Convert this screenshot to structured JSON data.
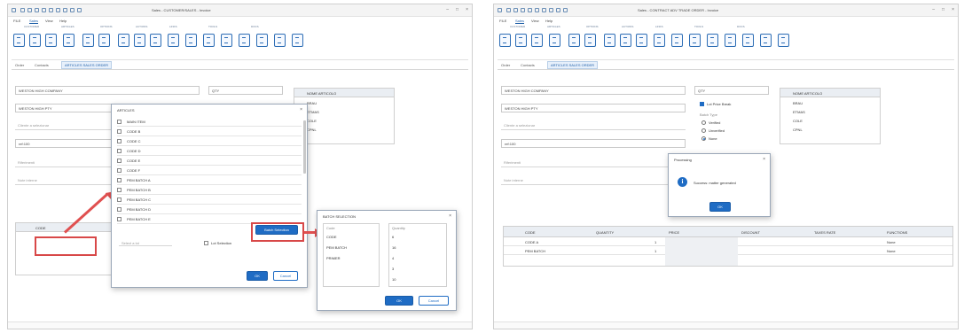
{
  "left": {
    "title_text": "Sales - CUSTOMER/SALES - Invoice",
    "menu": [
      "FILE",
      "Sales",
      "View",
      "Help"
    ],
    "menu_active_index": 1,
    "ribbon_groups": [
      "CUSTOMER",
      "ARTICLES",
      "OPTIONS",
      "ACTIONS",
      "LINKS",
      "TOOLS",
      "DOCS"
    ],
    "doc_tabs": [
      "Order",
      "Contacts",
      "ARTICLES SALES ORDER"
    ],
    "form": {
      "customer": "WESTON HIGH COMPANY",
      "customer_alt": "WESTON HIGH PTY",
      "qty_label": "QTY",
      "placeholder_1": "Cliente a selezionar",
      "ref": "ref:100",
      "field_b": "Riferimenti",
      "field_c": "Note interne"
    },
    "side_grid": {
      "header": "NOME ARTICOLO",
      "rows": [
        "BRAU",
        "ETMAS",
        "COLE",
        "CPNL"
      ]
    },
    "main_grid": {
      "header": "CODE"
    },
    "article_dialog": {
      "title": "ARTICLES",
      "items": [
        "MAIN ITEM",
        "CODE B",
        "CODE C",
        "CODE D",
        "CODE E",
        "CODE F",
        "PEM BATCH A",
        "PEM BATCH B",
        "PEM BATCH C",
        "PEM BATCH D",
        "PEM BATCH E"
      ],
      "button_label": "Batch Selection",
      "ok": "OK",
      "cancel": "Cancel",
      "footer_check": "Lot Selection",
      "footer_left": "Select a lot"
    },
    "batch_dialog": {
      "title": "BATCH SELECTION",
      "col_a": "Code",
      "col_b": "Quantity",
      "rows_a": [
        "CODE",
        "PEM BATCH",
        "PRIMER"
      ],
      "rows_b": [
        "6",
        "16",
        "4",
        "3",
        "10"
      ],
      "ok": "OK",
      "cancel": "Cancel"
    }
  },
  "right": {
    "title_text": "Sales - CONTRACT ADV TRADE ORDER - Invoice",
    "menu": [
      "FILE",
      "Sales",
      "View",
      "Help"
    ],
    "menu_active_index": 1,
    "ribbon_groups": [
      "CUSTOMER",
      "ARTICLES",
      "OPTIONS",
      "ACTIONS",
      "LINKS",
      "TOOLS",
      "DOCS"
    ],
    "doc_tabs": [
      "Order",
      "Contacts",
      "ARTICLES SALES ORDER"
    ],
    "form": {
      "customer": "WESTON HIGH COMPANY",
      "customer_alt": "WESTON HIGH PTY",
      "qty_label": "QTY",
      "placeholder_1": "Cliente a selezionar",
      "ref": "ref:100",
      "field_b": "Riferimenti",
      "field_c": "Note interne"
    },
    "options_panel": {
      "check_label": "Lot Price Break",
      "group_label": "Batch Type",
      "radios": [
        "Verified",
        "Unverified",
        "None"
      ],
      "selected_radio": 2
    },
    "side_grid": {
      "header": "NOME ARTICOLO",
      "rows": [
        "BRAU",
        "ETMAS",
        "COLE",
        "CPNL"
      ]
    },
    "message_box": {
      "title": "Processing",
      "message": "Success: matter generated",
      "ok": "OK",
      "icon": "info-icon"
    },
    "main_grid": {
      "headers": [
        "CODE",
        "QUANTITY",
        "PRICE",
        "DISCOUNT",
        "TAXES RATE",
        "FUNCTIONS"
      ],
      "rows": [
        [
          "CODE A",
          "1",
          "",
          "",
          "",
          "None"
        ],
        [
          "PEM BATCH",
          "1",
          "",
          "",
          "",
          "None"
        ]
      ]
    }
  },
  "colors": {
    "accent": "#1f6cc4",
    "highlight": "#d84848",
    "arrow": "#e05050"
  }
}
